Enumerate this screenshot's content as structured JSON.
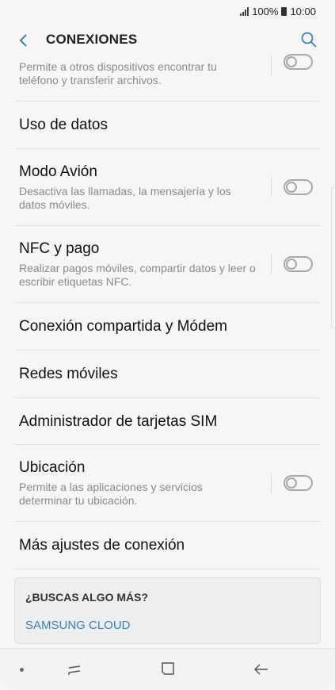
{
  "status": {
    "signal_icon": "signal-icon",
    "battery_pct": "100%",
    "battery_icon": "battery-icon",
    "time": "10:00"
  },
  "header": {
    "title": "CONEXIONES",
    "back_icon": "chevron-left-icon",
    "search_icon": "search-icon"
  },
  "items": [
    {
      "title": "",
      "subtitle": "Permite a otros dispositivos encontrar tu teléfono y transferir archivos.",
      "toggle": false
    },
    {
      "title": "Uso de datos"
    },
    {
      "title": "Modo Avión",
      "subtitle": "Desactiva las llamadas, la mensajería y los datos móviles.",
      "toggle": false
    },
    {
      "title": "NFC y pago",
      "subtitle": "Realizar pagos móviles, compartir datos y leer o escribir etiquetas NFC.",
      "toggle": false
    },
    {
      "title": "Conexión compartida y Módem"
    },
    {
      "title": "Redes móviles"
    },
    {
      "title": "Administrador de tarjetas SIM"
    },
    {
      "title": "Ubicación",
      "subtitle": "Permite a las aplicaciones y servicios determinar tu ubicación.",
      "toggle": false
    },
    {
      "title": "Más ajustes de conexión"
    }
  ],
  "more": {
    "question": "¿BUSCAS ALGO MÁS?",
    "link": "SAMSUNG CLOUD",
    "link_color": "#3b7fb7"
  },
  "nav": {
    "recent_icon": "recent-apps-icon",
    "home_icon": "home-icon",
    "back_icon": "back-arrow-icon"
  }
}
